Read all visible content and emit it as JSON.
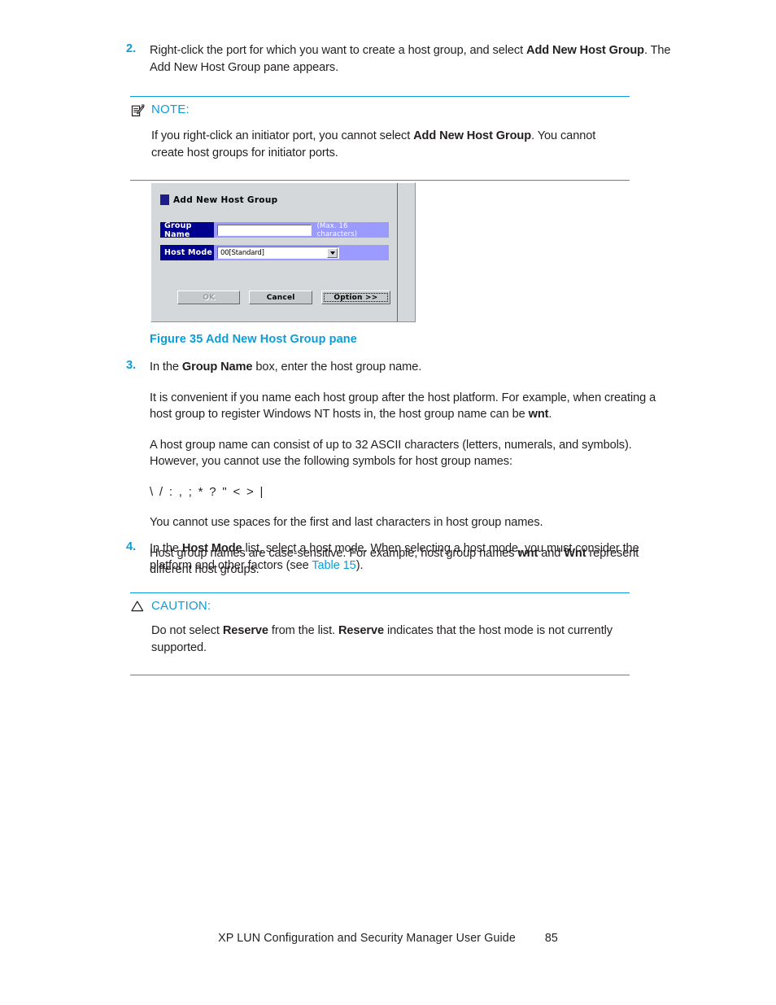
{
  "page": {
    "footer_title": "XP LUN Configuration and Security Manager User Guide",
    "footer_page": "85"
  },
  "step2": {
    "number": "2.",
    "text_before": "Right-click the port for which you want to create a host group, and select ",
    "bold": "Add New Host Group",
    "text_after": ". The Add New Host Group pane appears."
  },
  "note": {
    "icon": "note-pad-icon",
    "title": "NOTE:",
    "text_before": "If you right-click an initiator port, you cannot select ",
    "bold": "Add New Host Group",
    "text_after": ". You cannot create host groups for initiator ports."
  },
  "figure": {
    "caption": "Figure 35 Add New Host Group pane",
    "dialog": {
      "title": "Add New Host Group",
      "group_name_label": "Group Name",
      "group_name_value": "",
      "group_name_hint": "(Max. 16 characters)",
      "host_mode_label": "Host Mode",
      "host_mode_value": "00[Standard]",
      "buttons": {
        "ok": "OK",
        "cancel": "Cancel",
        "option": "Option >>"
      }
    }
  },
  "step3": {
    "number": "3.",
    "p1_before": "In the ",
    "p1_bold": "Group Name",
    "p1_after": " box, enter the host group name.",
    "p2_before": "It is convenient if you name each host group after the host platform. For example, when creating a host group to register Windows NT hosts in, the host group name can be ",
    "p2_bold": "wnt",
    "p2_after": ".",
    "p3": "A host group name can consist of up to 32 ASCII characters (letters, numerals, and symbols). However, you cannot use the following symbols for host group names:",
    "p4_symbols": "\\ / : , ; * ? \" < > |",
    "p5": "You cannot use spaces for the first and last characters in host group names.",
    "p6_before": "Host group names are case-sensitive. For example, host group names ",
    "p6_bold1": "wnt",
    "p6_mid": " and ",
    "p6_bold2": "Wnt",
    "p6_after": " represent different host groups."
  },
  "step4": {
    "number": "4.",
    "text_before": "In the ",
    "bold": "Host Mode",
    "text_mid": " list, select a host mode. When selecting a host mode, you must consider the platform and other factors (see ",
    "link": "Table 15",
    "text_after": ")."
  },
  "caution": {
    "icon": "warning-triangle-icon",
    "title": "CAUTION:",
    "text_before": "Do not select ",
    "bold1": "Reserve",
    "text_mid": " from the list. ",
    "bold2": "Reserve",
    "text_after": " indicates that the host mode is not currently supported."
  },
  "colors": {
    "accent": "#0b9dd9",
    "dialog_label_bg": "#00008f",
    "dialog_field_bg": "#9a9aff",
    "dialog_bg": "#d4d8da"
  }
}
